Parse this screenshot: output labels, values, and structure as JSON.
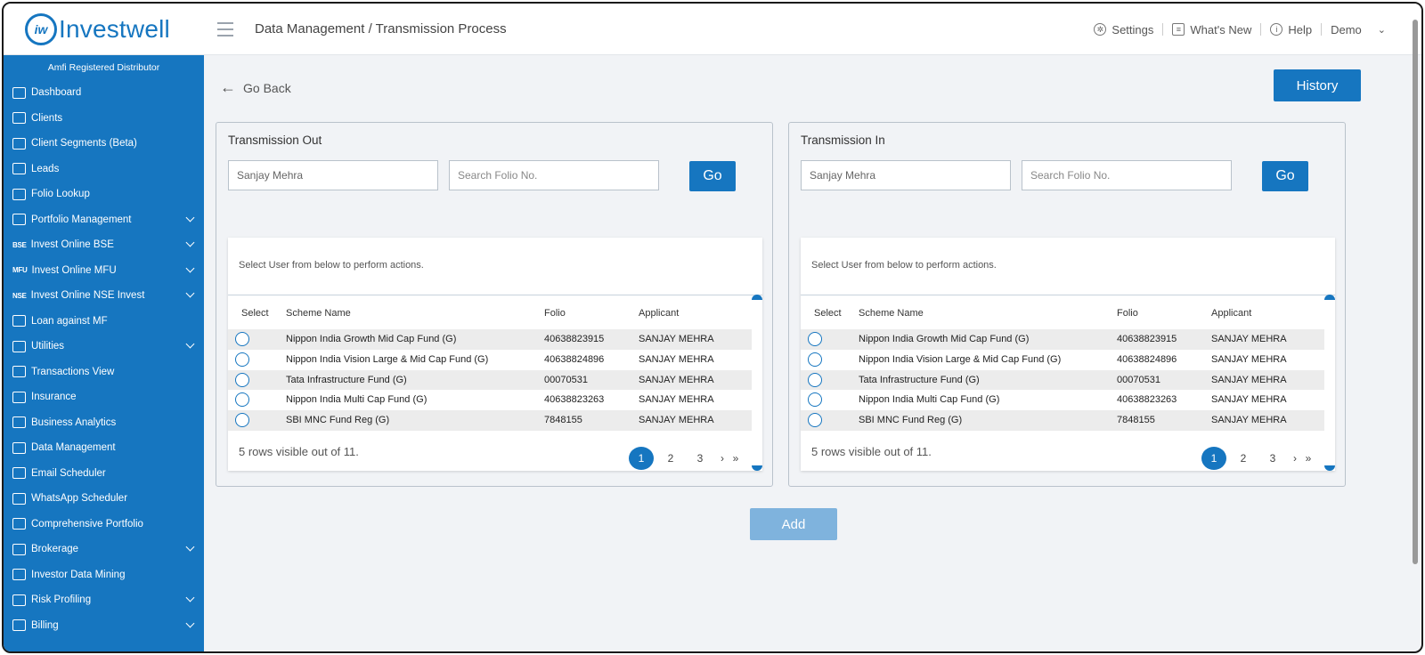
{
  "brand": {
    "name": "Investwell",
    "mark": "iw"
  },
  "header": {
    "breadcrumb": "Data Management / Transmission Process",
    "settings": "Settings",
    "whats_new": "What's New",
    "help": "Help",
    "user": "Demo"
  },
  "sidebar": {
    "subtitle": "Amfi Registered Distributor",
    "items": [
      {
        "label": "Dashboard",
        "icon": "home-icon",
        "expand": false
      },
      {
        "label": "Clients",
        "icon": "users-icon",
        "expand": false
      },
      {
        "label": "Client Segments (Beta)",
        "icon": "users-icon",
        "expand": false
      },
      {
        "label": "Leads",
        "icon": "leads-icon",
        "expand": false
      },
      {
        "label": "Folio Lookup",
        "icon": "folio-lookup-icon",
        "expand": false
      },
      {
        "label": "Portfolio Management",
        "icon": "briefcase-icon",
        "expand": true
      },
      {
        "label": "Invest Online BSE",
        "icon": "bse-icon",
        "icon_text": "BSE",
        "expand": true
      },
      {
        "label": "Invest Online MFU",
        "icon": "mfu-icon",
        "icon_text": "MFU",
        "expand": true
      },
      {
        "label": "Invest Online NSE Invest",
        "icon": "nse-icon",
        "icon_text": "NSE",
        "expand": true
      },
      {
        "label": "Loan against MF",
        "icon": "loan-icon",
        "expand": false
      },
      {
        "label": "Utilities",
        "icon": "utilities-icon",
        "expand": true
      },
      {
        "label": "Transactions View",
        "icon": "transactions-icon",
        "expand": false
      },
      {
        "label": "Insurance",
        "icon": "insurance-icon",
        "expand": false
      },
      {
        "label": "Business Analytics",
        "icon": "analytics-icon",
        "expand": false
      },
      {
        "label": "Data Management",
        "icon": "data-icon",
        "expand": false
      },
      {
        "label": "Email Scheduler",
        "icon": "email-icon",
        "expand": false
      },
      {
        "label": "WhatsApp Scheduler",
        "icon": "whatsapp-icon",
        "expand": false
      },
      {
        "label": "Comprehensive Portfolio",
        "icon": "portfolio-icon",
        "expand": false
      },
      {
        "label": "Brokerage",
        "icon": "brokerage-icon",
        "expand": true
      },
      {
        "label": "Investor Data Mining",
        "icon": "mining-icon",
        "expand": false
      },
      {
        "label": "Risk Profiling",
        "icon": "risk-icon",
        "expand": true
      },
      {
        "label": "Billing",
        "icon": "billing-icon",
        "expand": true
      }
    ]
  },
  "main": {
    "go_back": "Go Back",
    "history": "History",
    "add": "Add",
    "panels": [
      {
        "title": "Transmission Out",
        "name_value": "Sanjay Mehra",
        "folio_placeholder": "Search Folio No.",
        "go": "Go",
        "hint": "Select User from below to perform actions.",
        "columns": [
          "Select",
          "Scheme Name",
          "Folio",
          "Applicant"
        ],
        "rows": [
          {
            "scheme": "Nippon India Growth Mid Cap Fund (G)",
            "folio": "40638823915",
            "applicant": "SANJAY MEHRA"
          },
          {
            "scheme": "Nippon India Vision Large & Mid Cap Fund (G)",
            "folio": "40638824896",
            "applicant": "SANJAY MEHRA"
          },
          {
            "scheme": "Tata Infrastructure Fund (G)",
            "folio": "00070531",
            "applicant": "SANJAY MEHRA"
          },
          {
            "scheme": "Nippon India Multi Cap Fund (G)",
            "folio": "40638823263",
            "applicant": "SANJAY MEHRA"
          },
          {
            "scheme": "SBI MNC Fund Reg (G)",
            "folio": "7848155",
            "applicant": "SANJAY MEHRA"
          }
        ],
        "footer": "5  rows visible out of 11.",
        "pages": [
          "1",
          "2",
          "3"
        ],
        "next": "›",
        "last": "»"
      },
      {
        "title": "Transmission In",
        "name_value": "Sanjay Mehra",
        "folio_placeholder": "Search Folio No.",
        "go": "Go",
        "hint": "Select User from below to perform actions.",
        "columns": [
          "Select",
          "Scheme Name",
          "Folio",
          "Applicant"
        ],
        "rows": [
          {
            "scheme": "Nippon India Growth Mid Cap Fund (G)",
            "folio": "40638823915",
            "applicant": "SANJAY MEHRA"
          },
          {
            "scheme": "Nippon India Vision Large & Mid Cap Fund (G)",
            "folio": "40638824896",
            "applicant": "SANJAY MEHRA"
          },
          {
            "scheme": "Tata Infrastructure Fund (G)",
            "folio": "00070531",
            "applicant": "SANJAY MEHRA"
          },
          {
            "scheme": "Nippon India Multi Cap Fund (G)",
            "folio": "40638823263",
            "applicant": "SANJAY MEHRA"
          },
          {
            "scheme": "SBI MNC Fund Reg (G)",
            "folio": "7848155",
            "applicant": "SANJAY MEHRA"
          }
        ],
        "footer": "5  rows visible out of 11.",
        "pages": [
          "1",
          "2",
          "3"
        ],
        "next": "›",
        "last": "»"
      }
    ]
  },
  "colors": {
    "brand": "#1676c0",
    "add_disabled": "#7fb3dd",
    "background": "#f1f3f6"
  }
}
